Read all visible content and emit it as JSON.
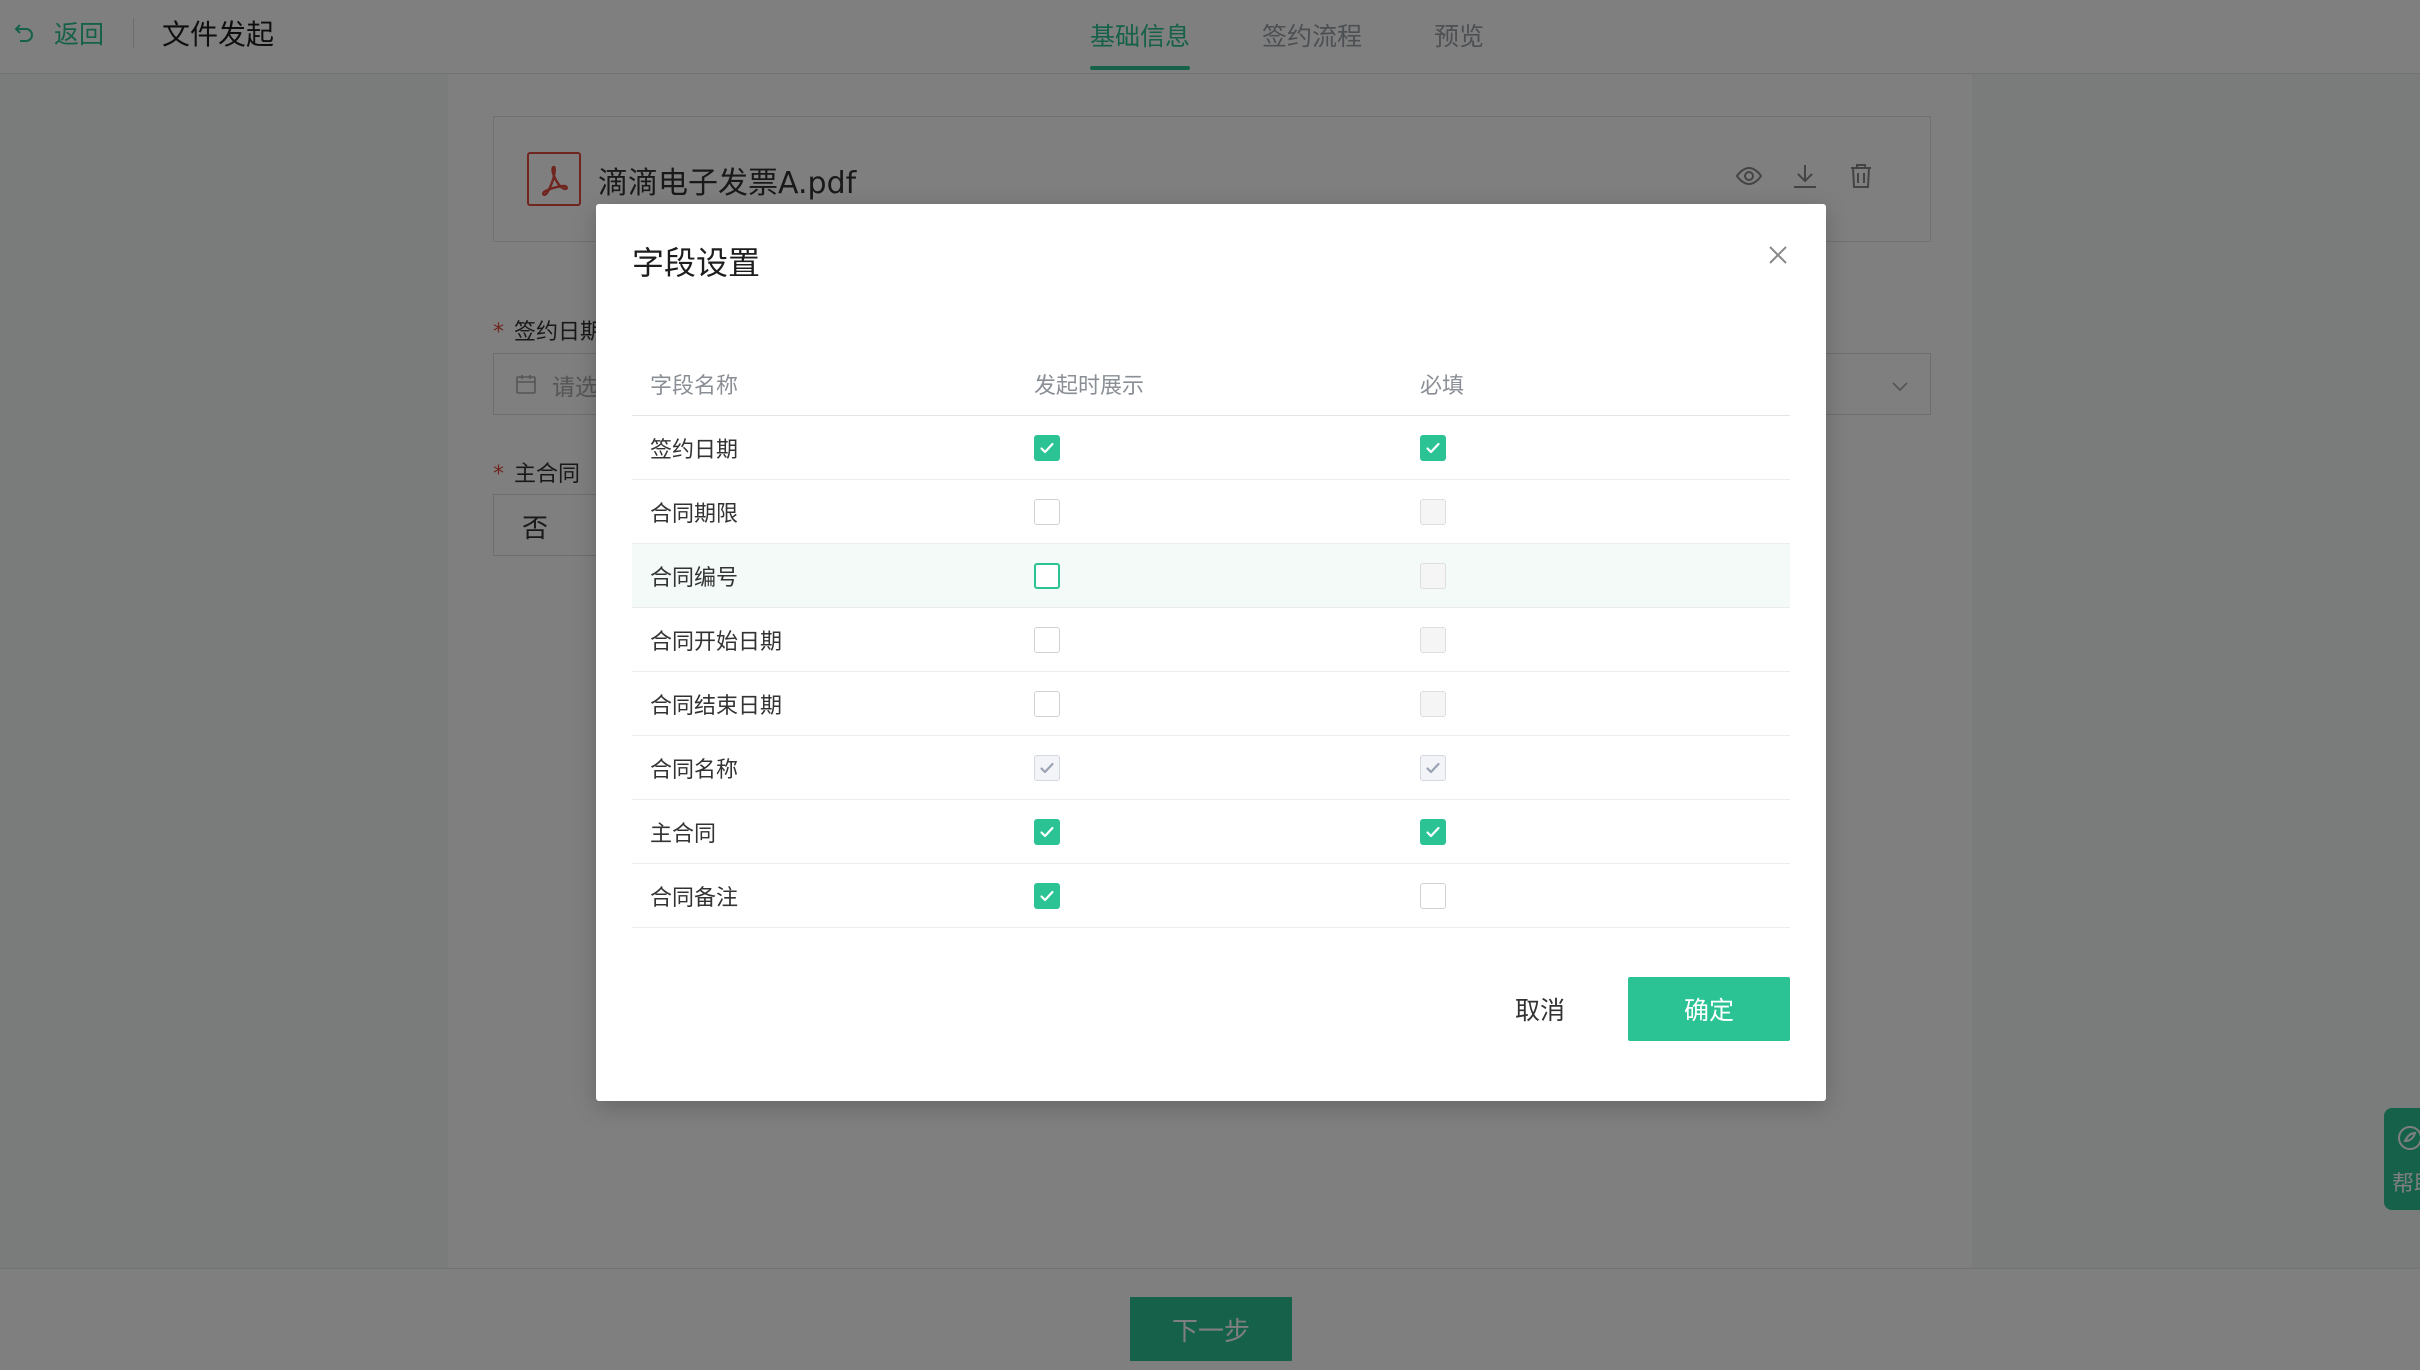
{
  "header": {
    "back_label": "返回",
    "title": "文件发起",
    "tabs": [
      {
        "label": "基础信息",
        "active": true
      },
      {
        "label": "签约流程",
        "active": false
      },
      {
        "label": "预览",
        "active": false
      }
    ]
  },
  "file": {
    "name": "滴滴电子发票A.pdf",
    "icon": "pdf-icon",
    "actions": [
      "eye-icon",
      "download-icon",
      "trash-icon"
    ]
  },
  "form": {
    "sign_date_label": "签约日期",
    "sign_date_placeholder": "请选",
    "main_contract_label": "主合同",
    "main_contract_value": "否"
  },
  "footer": {
    "next_label": "下一步"
  },
  "help": {
    "label": "帮助"
  },
  "modal": {
    "title": "字段设置",
    "columns": [
      "字段名称",
      "发起时展示",
      "必填"
    ],
    "rows": [
      {
        "name": "签约日期",
        "show": "on",
        "required": "on"
      },
      {
        "name": "合同期限",
        "show": "off",
        "required": "disabled"
      },
      {
        "name": "合同编号",
        "show": "focus",
        "required": "disabled"
      },
      {
        "name": "合同开始日期",
        "show": "off",
        "required": "disabled"
      },
      {
        "name": "合同结束日期",
        "show": "off",
        "required": "disabled"
      },
      {
        "name": "合同名称",
        "show": "disabled-on",
        "required": "disabled-on"
      },
      {
        "name": "主合同",
        "show": "on",
        "required": "on"
      },
      {
        "name": "合同备注",
        "show": "on",
        "required": "off"
      }
    ],
    "cancel_label": "取消",
    "ok_label": "确定"
  },
  "colors": {
    "accent": "#2cc394",
    "danger": "#e04b3f"
  }
}
